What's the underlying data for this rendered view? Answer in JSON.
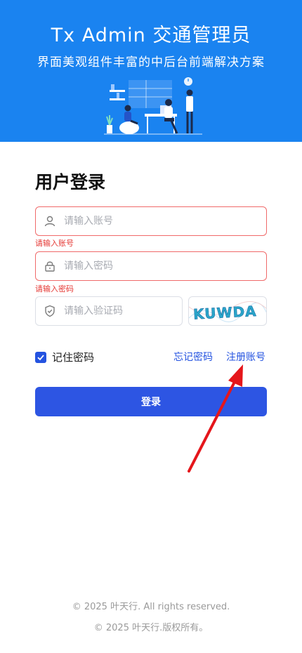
{
  "header": {
    "title": "Tx Admin  交通管理员",
    "subtitle": "界面美观组件丰富的中后台前端解决方案"
  },
  "login": {
    "heading": "用户登录",
    "account": {
      "placeholder": "请输入账号",
      "error": "请输入账号",
      "icon": "user-icon"
    },
    "password": {
      "placeholder": "请输入密码",
      "error": "请输入密码",
      "icon": "lock-icon"
    },
    "captcha": {
      "placeholder": "请输入验证码",
      "icon": "shield-check-icon",
      "image_text": "KUWDA"
    },
    "remember_label": "记住密码",
    "remember_checked": true,
    "forgot_link": "忘记密码",
    "register_link": "注册账号",
    "submit_label": "登录"
  },
  "footer": {
    "line1": "© 2025 叶天行. All rights reserved.",
    "line2": "© 2025 叶天行.版权所有。"
  },
  "colors": {
    "header_bg": "#1a83f0",
    "primary": "#2d55e3",
    "error": "#e53935",
    "annotation_arrow": "#e5161b"
  }
}
